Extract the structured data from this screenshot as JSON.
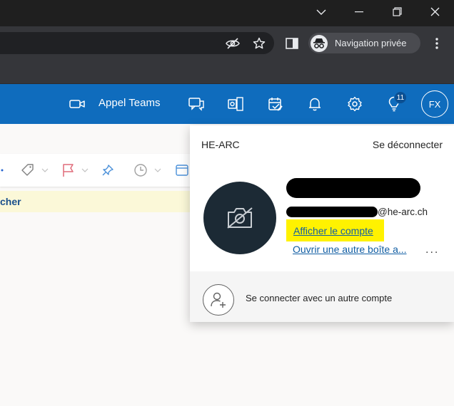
{
  "browser": {
    "incognito_label": "Navigation privée"
  },
  "header": {
    "teams_label": "Appel Teams",
    "notification_count": "11",
    "account_initials": "FX",
    "brand_color": "#0f6cbd"
  },
  "page": {
    "notice_text": "cher"
  },
  "account_flyout": {
    "organization": "HE-ARC",
    "sign_out": "Se déconnecter",
    "email_domain": "@he-arc.ch",
    "view_account": "Afficher le compte",
    "open_other_mailbox": "Ouvrir une autre boîte a...",
    "more": "...",
    "sign_in_other": "Se connecter avec un autre compte",
    "highlight_color": "#fff200"
  }
}
